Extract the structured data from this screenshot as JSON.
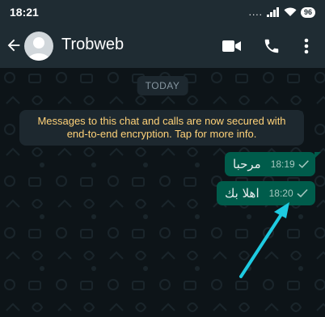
{
  "status_bar": {
    "time": "18:21",
    "signal_text": "....",
    "battery": "96"
  },
  "header": {
    "contact_name": "Trobweb",
    "icons": [
      "back-arrow-icon",
      "avatar",
      "video-call-icon",
      "phone-icon",
      "more-vert-icon"
    ]
  },
  "chat": {
    "date_chip": "TODAY",
    "encryption_notice": "Messages to this chat and calls are now secured with end-to-end encryption. Tap for more info.",
    "messages": [
      {
        "text": "مرحبا",
        "time": "18:19",
        "status": "sent-check"
      },
      {
        "text": "اهلا بك",
        "time": "18:20",
        "status": "sent-check"
      }
    ]
  },
  "colors": {
    "header_bg": "#1f2c33",
    "chat_bg": "#0d1418",
    "outgoing_bubble": "#005c4b",
    "notice_text": "#ffd279",
    "annotation_arrow": "#1ecbe1"
  }
}
